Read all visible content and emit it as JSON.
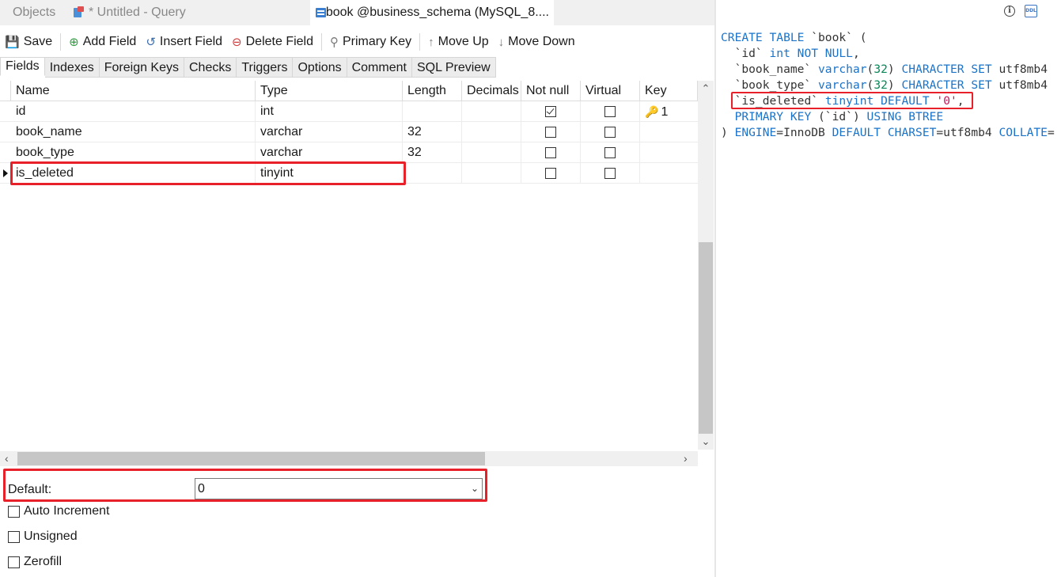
{
  "doc_tabs": [
    {
      "label": "Objects"
    },
    {
      "label": "* Untitled - Query"
    },
    {
      "label": "book @business_schema (MySQL_8...."
    }
  ],
  "toolbar": {
    "save": "Save",
    "add_field": "Add Field",
    "insert_field": "Insert Field",
    "delete_field": "Delete Field",
    "primary_key": "Primary Key",
    "move_up": "Move Up",
    "move_down": "Move Down"
  },
  "sub_tabs": [
    "Fields",
    "Indexes",
    "Foreign Keys",
    "Checks",
    "Triggers",
    "Options",
    "Comment",
    "SQL Preview"
  ],
  "grid": {
    "headers": {
      "name": "Name",
      "type": "Type",
      "length": "Length",
      "decimals": "Decimals",
      "not_null": "Not null",
      "virtual": "Virtual",
      "key": "Key"
    },
    "rows": [
      {
        "name": "id",
        "type": "int",
        "length": "",
        "decimals": "",
        "not_null": true,
        "virtual": false,
        "key": "1"
      },
      {
        "name": "book_name",
        "type": "varchar",
        "length": "32",
        "decimals": "",
        "not_null": false,
        "virtual": false,
        "key": ""
      },
      {
        "name": "book_type",
        "type": "varchar",
        "length": "32",
        "decimals": "",
        "not_null": false,
        "virtual": false,
        "key": ""
      },
      {
        "name": "is_deleted",
        "type": "tinyint",
        "length": "",
        "decimals": "",
        "not_null": false,
        "virtual": false,
        "key": ""
      }
    ],
    "selected_row": 3
  },
  "props": {
    "default_label": "Default:",
    "default_value": "0",
    "auto_increment": "Auto Increment",
    "unsigned": "Unsigned",
    "zerofill": "Zerofill"
  },
  "sql": {
    "line1_kw": "CREATE TABLE",
    "line1_tbl": " `book` (",
    "line2_col": "  `id` ",
    "line2_type": "int NOT NULL",
    "line2_end": ",",
    "line3_col": "  `book_name` ",
    "line3_type": "varchar",
    "line3_len": "32",
    "line3_cs": "CHARACTER SET",
    "line3_end": " utf8mb4",
    "line4_col": "  `book_type` ",
    "line4_type": "varchar",
    "line4_len": "32",
    "line4_cs": "CHARACTER SET",
    "line4_end": " utf8mb4",
    "line5_col": "`is_deleted` ",
    "line5_type": "tinyint DEFAULT",
    "line5_val": "'0'",
    "line5_end": ",",
    "line6_kw": "PRIMARY KEY",
    "line6_col": " (`id`) ",
    "line6_kw2": "USING BTREE",
    "line7_start": ") ",
    "line7_engine": "ENGINE",
    "line7_eq1": "=InnoDB ",
    "line7_default": "DEFAULT CHARSET",
    "line7_eq2": "=utf8mb4 ",
    "line7_collate": "COLLATE",
    "line7_eq3": "="
  },
  "colors": {
    "highlight": "#e8202a",
    "keyword": "#1a73c9",
    "number": "#098658",
    "string": "#c2185b"
  }
}
